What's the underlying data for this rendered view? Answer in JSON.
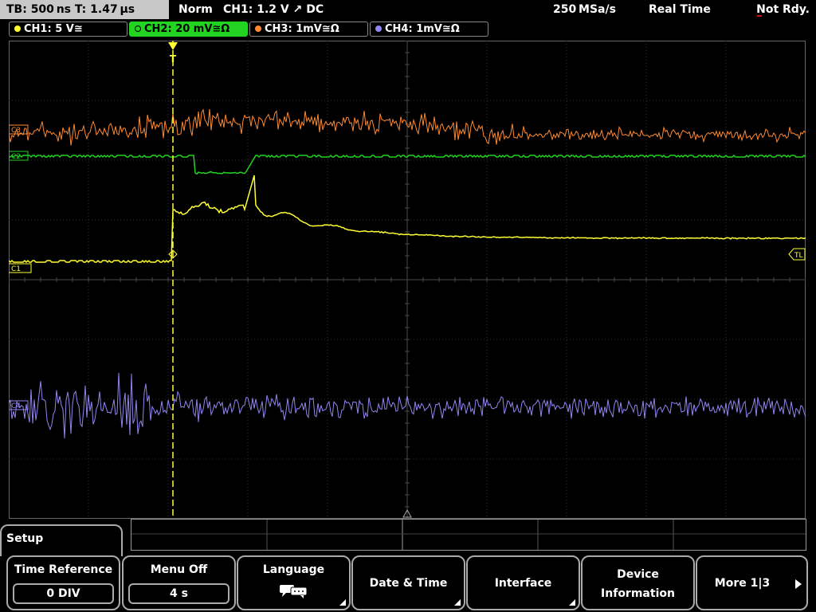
{
  "status": {
    "timebase": "TB: 500 ns   T: 1.47 µs",
    "mode": "Norm",
    "trigger": "CH1: 1.2 V ↗ DC",
    "sample_rate": "250 MSa/s",
    "acq_mode": "Real Time",
    "ready_state": "Not Rdy."
  },
  "channels": [
    {
      "label": "CH1: 5 V≅",
      "color": "#ffff33"
    },
    {
      "label": "CH2: 20 mV≅Ω",
      "color": "#22d322"
    },
    {
      "label": "CH3: 1mV≅Ω",
      "color": "#ff8a33"
    },
    {
      "label": "CH4: 1mV≅Ω",
      "color": "#8f86f0"
    }
  ],
  "markers": {
    "ch1": "C1",
    "ch2": "C2",
    "ch3": "C3",
    "ch4": "C4",
    "trigger_level": "TL",
    "trigger_top": "T"
  },
  "menu": {
    "title": "Setup",
    "softkeys": [
      {
        "label": "Time Reference",
        "value": "0 DIV"
      },
      {
        "label": "Menu Off",
        "value": "4 s"
      },
      {
        "label": "Language",
        "icon": "speech-bubble-icon"
      },
      {
        "label": "Date & Time"
      },
      {
        "label": "Interface"
      },
      {
        "label": "Device",
        "label2": "Information"
      },
      {
        "label": "More 1|3"
      }
    ]
  }
}
